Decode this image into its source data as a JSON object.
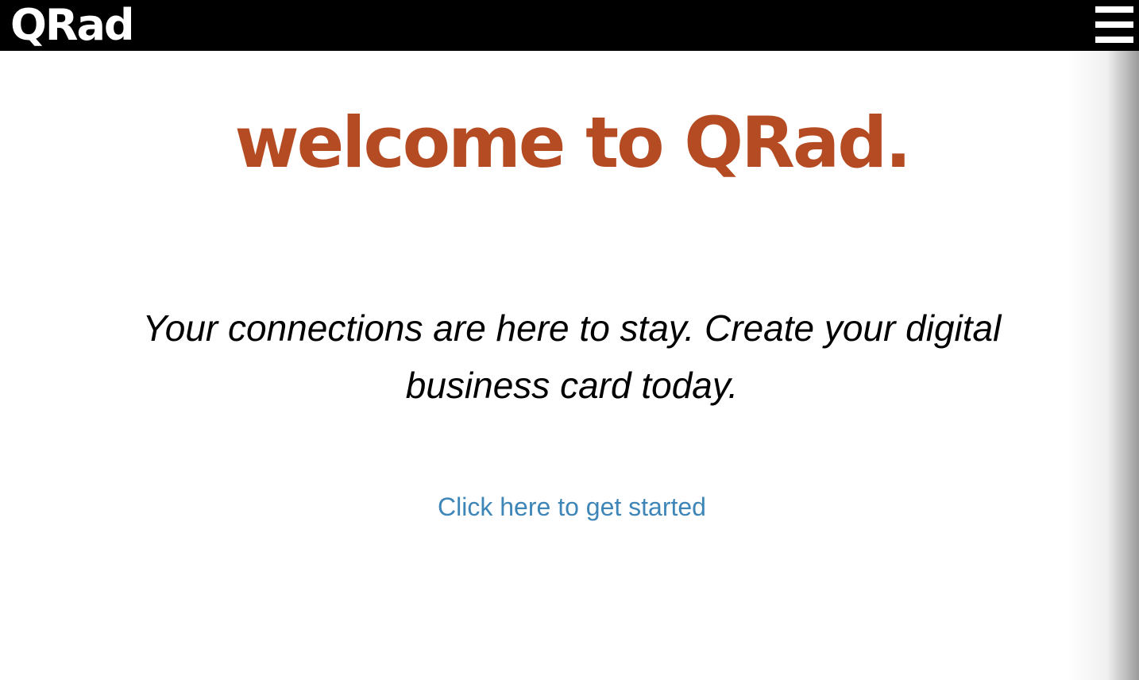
{
  "header": {
    "logo_text": "QRad",
    "menu_icon": "hamburger-menu-icon"
  },
  "main": {
    "headline": "welcome to QRad.",
    "tagline": "Your connections are here to stay. Create your digital business card today.",
    "cta_link": "Click here to get started"
  },
  "colors": {
    "header_bg": "#000000",
    "headline": "#b54b22",
    "link": "#3f86b8",
    "body_text": "#000000",
    "background": "#ffffff"
  }
}
